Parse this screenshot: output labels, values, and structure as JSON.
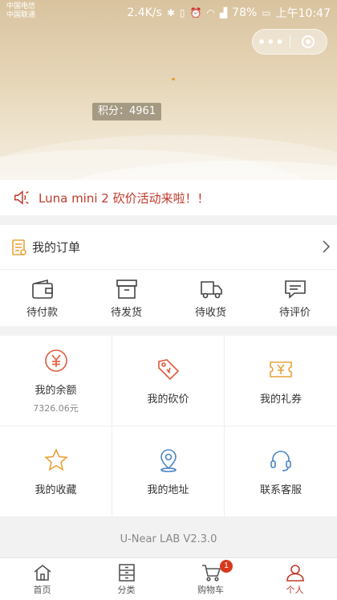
{
  "status_bar": {
    "carrier_1": "中国电信",
    "carrier_2": "中国联通",
    "speed": "2.4K/s",
    "battery": "78%",
    "time": "上午10:47"
  },
  "header": {
    "points_label": "积分：4961"
  },
  "notice": {
    "text": "Luna mini 2 砍价活动来啦！！"
  },
  "orders": {
    "title": "我的订单",
    "items": [
      {
        "label": "待付款",
        "icon": "wallet-icon"
      },
      {
        "label": "待发货",
        "icon": "box-icon"
      },
      {
        "label": "待收货",
        "icon": "truck-icon"
      },
      {
        "label": "待评价",
        "icon": "comment-icon"
      }
    ]
  },
  "services": [
    {
      "label": "我的余额",
      "sub": "7326.06元",
      "icon": "yen-coin-icon"
    },
    {
      "label": "我的砍价",
      "icon": "price-tag-icon"
    },
    {
      "label": "我的礼券",
      "icon": "coupon-icon"
    },
    {
      "label": "我的收藏",
      "icon": "star-icon"
    },
    {
      "label": "我的地址",
      "icon": "location-pin-icon"
    },
    {
      "label": "联系客服",
      "icon": "headset-icon"
    }
  ],
  "version": "U-Near LAB V2.3.0",
  "tabbar": [
    {
      "label": "首页",
      "icon": "home-icon"
    },
    {
      "label": "分类",
      "icon": "drawer-icon"
    },
    {
      "label": "购物车",
      "icon": "cart-icon",
      "badge": "1"
    },
    {
      "label": "个人",
      "icon": "person-icon",
      "active": true
    }
  ],
  "colors": {
    "accent": "#c0392b",
    "header_gold": "#d9c39f",
    "badge": "#d9381e"
  }
}
